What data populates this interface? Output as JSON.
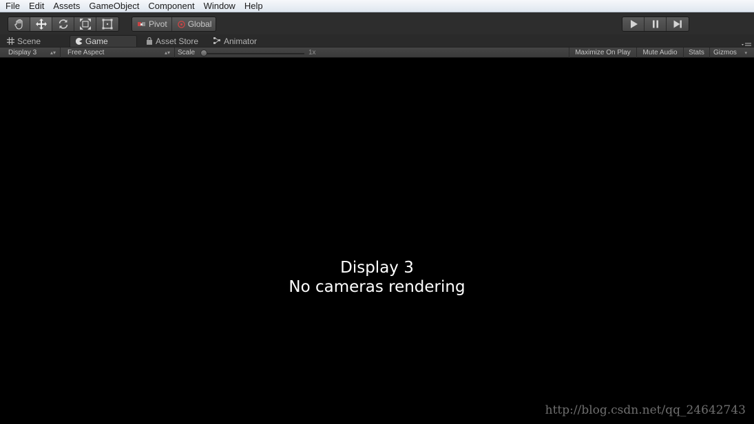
{
  "menu": [
    "File",
    "Edit",
    "Assets",
    "GameObject",
    "Component",
    "Window",
    "Help"
  ],
  "toolbar": {
    "tools": [
      "hand-icon",
      "move-icon",
      "rotate-icon",
      "scale-icon",
      "rect-icon"
    ],
    "pivot_label": "Pivot",
    "global_label": "Global",
    "play_controls": [
      "play-icon",
      "pause-icon",
      "step-icon"
    ]
  },
  "tabs": [
    {
      "label": "Scene",
      "icon": "grid-icon",
      "active": false
    },
    {
      "label": "Game",
      "icon": "pacman-icon",
      "active": true
    },
    {
      "label": "Asset Store",
      "icon": "bag-icon",
      "active": false
    },
    {
      "label": "Animator",
      "icon": "animator-icon",
      "active": false
    }
  ],
  "game_toolbar": {
    "display": "Display 3",
    "aspect": "Free Aspect",
    "scale_label": "Scale",
    "scale_value": "1x",
    "maximize": "Maximize On Play",
    "mute": "Mute Audio",
    "stats": "Stats",
    "gizmos": "Gizmos"
  },
  "game_view": {
    "line1": "Display 3",
    "line2": "No cameras rendering"
  },
  "watermark": "http://blog.csdn.net/qq_24642743",
  "colors": {
    "menubar": "#e4eaf2",
    "toolbar": "#2d2d2d",
    "gameview": "#000000"
  }
}
